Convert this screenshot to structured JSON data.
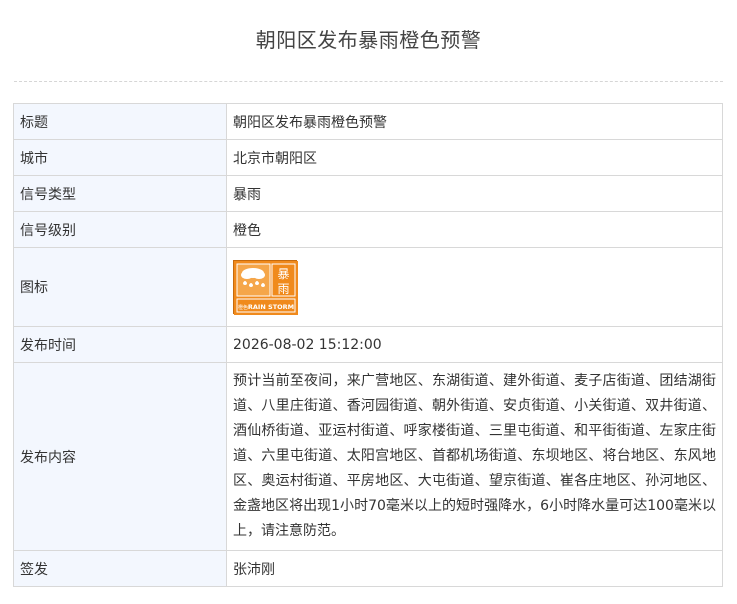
{
  "page": {
    "title": "朝阳区发布暴雨橙色预警"
  },
  "rows": [
    {
      "label": "标题",
      "value": "朝阳区发布暴雨橙色预警"
    },
    {
      "label": "城市",
      "value": "北京市朝阳区"
    },
    {
      "label": "信号类型",
      "value": "暴雨"
    },
    {
      "label": "信号级别",
      "value": "橙色"
    },
    {
      "label": "图标",
      "value": ""
    },
    {
      "label": "发布时间",
      "value": "2026-08-02 15:12:00"
    },
    {
      "label": "发布内容",
      "value": "预计当前至夜间，来广营地区、东湖街道、建外街道、麦子店街道、团结湖街道、八里庄街道、香河园街道、朝外街道、安贞街道、小关街道、双井街道、酒仙桥街道、亚运村街道、呼家楼街道、三里屯街道、和平街街道、左家庄街道、六里屯街道、太阳宫地区、首都机场街道、东坝地区、将台地区、东风地区、奥运村街道、平房地区、大屯街道、望京街道、崔各庄地区、孙河地区、金盏地区将出现1小时70毫米以上的短时强降水，6小时降水量可达100毫米以上，请注意防范。"
    },
    {
      "label": "签发",
      "value": "张沛刚"
    }
  ],
  "icon": {
    "name": "rain-storm-orange-warning-icon",
    "text_cn_top": "暴",
    "text_cn_bottom": "雨",
    "text_cn_level": "橙色",
    "text_en": "RAIN STORM",
    "color": "#f08a1c"
  }
}
